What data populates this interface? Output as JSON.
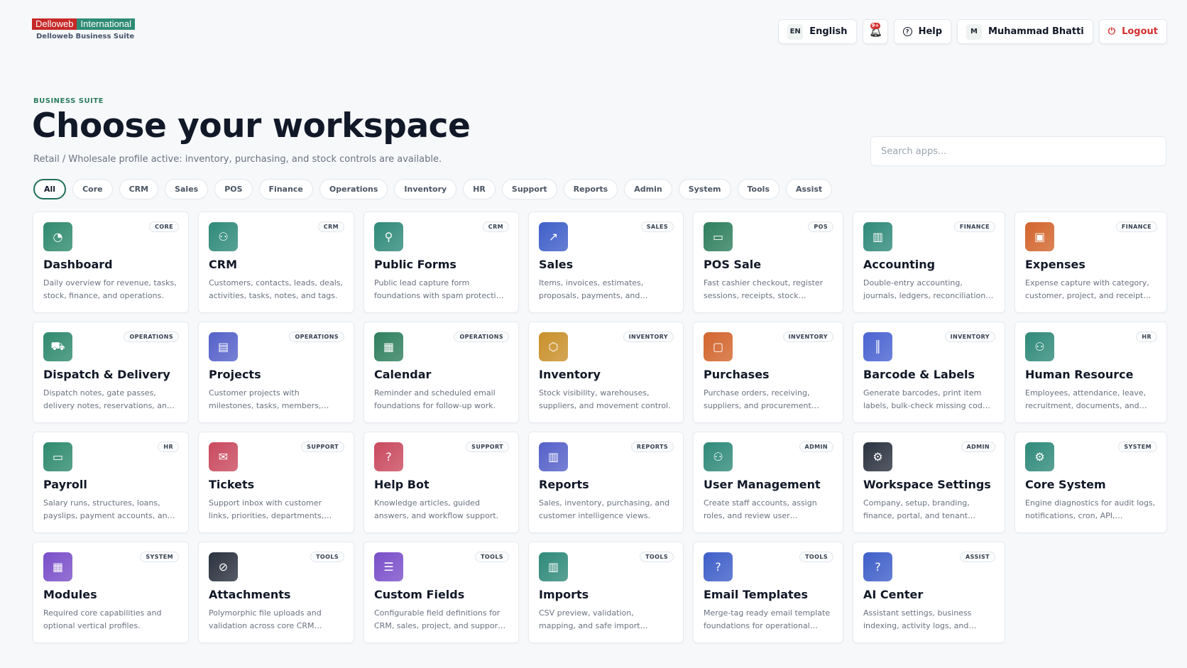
{
  "brand": {
    "logo_left": "Delloweb",
    "logo_right": "International",
    "subtitle": "Delloweb Business Suite"
  },
  "topbar": {
    "language_code": "EN",
    "language_label": "English",
    "notification_count": "9+",
    "help_label": "Help",
    "user_initial": "M",
    "user_name": "Muhammad Bhatti",
    "logout_label": "Logout"
  },
  "hero": {
    "eyebrow": "BUSINESS SUITE",
    "title": "Choose your workspace",
    "subtitle": "Retail / Wholesale profile active: inventory, purchasing, and stock controls are available."
  },
  "search": {
    "placeholder": "Search apps..."
  },
  "filters": [
    "All",
    "Core",
    "CRM",
    "Sales",
    "POS",
    "Finance",
    "Operations",
    "Inventory",
    "HR",
    "Support",
    "Reports",
    "Admin",
    "System",
    "Tools",
    "Assist"
  ],
  "active_filter": "All",
  "apps": [
    {
      "name": "Dashboard",
      "tag": "CORE",
      "desc": "Daily overview for revenue, tasks, stock, finance, and operations.",
      "icon": "gauge-icon",
      "glyph": "◔",
      "color": "#2f8a6e"
    },
    {
      "name": "CRM",
      "tag": "CRM",
      "desc": "Customers, contacts, leads, deals, activities, tasks, notes, and tags.",
      "icon": "users-icon",
      "glyph": "⚇",
      "color": "#2f8a7a"
    },
    {
      "name": "Public Forms",
      "tag": "CRM",
      "desc": "Public lead capture form foundations with spam protection and routing.",
      "icon": "form-icon",
      "glyph": "⚲",
      "color": "#2f8a7a"
    },
    {
      "name": "Sales",
      "tag": "SALES",
      "desc": "Items, invoices, estimates, proposals, payments, and revenue tracking.",
      "icon": "trend-icon",
      "glyph": "↗",
      "color": "#3f5fc9"
    },
    {
      "name": "POS Sale",
      "tag": "POS",
      "desc": "Fast cashier checkout, register sessions, receipts, stock deduction and more.",
      "icon": "card-icon",
      "glyph": "▭",
      "color": "#2f7f5e"
    },
    {
      "name": "Accounting",
      "tag": "FINANCE",
      "desc": "Double-entry accounting, journals, ledgers, reconciliation, period closing.",
      "icon": "bar-chart-icon",
      "glyph": "▥",
      "color": "#2f8a7a"
    },
    {
      "name": "Expenses",
      "tag": "FINANCE",
      "desc": "Expense capture with category, customer, project, and receipt tracking.",
      "icon": "wallet-icon",
      "glyph": "▣",
      "color": "#d2652d"
    },
    {
      "name": "Dispatch & Delivery",
      "tag": "OPERATIONS",
      "desc": "Dispatch notes, gate passes, delivery notes, reservations, and tracking.",
      "icon": "truck-icon",
      "glyph": "⛟",
      "color": "#2f8a6e"
    },
    {
      "name": "Projects",
      "tag": "OPERATIONS",
      "desc": "Customer projects with milestones, tasks, members, deadlines, and budgets.",
      "icon": "folder-icon",
      "glyph": "▤",
      "color": "#5561c9"
    },
    {
      "name": "Calendar",
      "tag": "OPERATIONS",
      "desc": "Reminder and scheduled email foundations for follow-up work.",
      "icon": "clipboard-icon",
      "glyph": "▦",
      "color": "#2f7f5e"
    },
    {
      "name": "Inventory",
      "tag": "INVENTORY",
      "desc": "Stock visibility, warehouses, suppliers, and movement control.",
      "icon": "box-icon",
      "glyph": "⬡",
      "color": "#c9902b"
    },
    {
      "name": "Purchases",
      "tag": "INVENTORY",
      "desc": "Purchase orders, receiving, suppliers, and procurement follow-up.",
      "icon": "bag-icon",
      "glyph": "▢",
      "color": "#d2652d"
    },
    {
      "name": "Barcode & Labels",
      "tag": "INVENTORY",
      "desc": "Generate barcodes, print item labels, bulk-check missing codes, and more.",
      "icon": "barcode-icon",
      "glyph": "║",
      "color": "#4a63d1"
    },
    {
      "name": "Human Resource",
      "tag": "HR",
      "desc": "Employees, attendance, leave, recruitment, documents, and payroll links.",
      "icon": "people-icon",
      "glyph": "⚇",
      "color": "#2f8a7a"
    },
    {
      "name": "Payroll",
      "tag": "HR",
      "desc": "Salary runs, structures, loans, payslips, payment accounts, and reports.",
      "icon": "money-icon",
      "glyph": "▭",
      "color": "#2f8a6e"
    },
    {
      "name": "Tickets",
      "tag": "SUPPORT",
      "desc": "Support inbox with customer links, priorities, departments, replies, and SLAs.",
      "icon": "ticket-icon",
      "glyph": "✉",
      "color": "#c94a5f"
    },
    {
      "name": "Help Bot",
      "tag": "SUPPORT",
      "desc": "Knowledge articles, guided answers, and workflow support.",
      "icon": "help-circle-icon",
      "glyph": "?",
      "color": "#c94a5f"
    },
    {
      "name": "Reports",
      "tag": "REPORTS",
      "desc": "Sales, inventory, purchasing, and customer intelligence views.",
      "icon": "bar-chart-icon",
      "glyph": "▥",
      "color": "#5561c9"
    },
    {
      "name": "User Management",
      "tag": "ADMIN",
      "desc": "Create staff accounts, assign roles, and review user permissions.",
      "icon": "user-group-icon",
      "glyph": "⚇",
      "color": "#2f8a7a"
    },
    {
      "name": "Workspace Settings",
      "tag": "ADMIN",
      "desc": "Company, setup, branding, finance, portal, and tenant configuration.",
      "icon": "gear-icon",
      "glyph": "⚙",
      "color": "#2b3340"
    },
    {
      "name": "Core System",
      "tag": "SYSTEM",
      "desc": "Engine diagnostics for audit logs, notifications, cron, API, webhooks.",
      "icon": "gear-icon",
      "glyph": "⚙",
      "color": "#2f8a7a"
    },
    {
      "name": "Modules",
      "tag": "SYSTEM",
      "desc": "Required core capabilities and optional vertical profiles.",
      "icon": "modules-icon",
      "glyph": "▦",
      "color": "#7a4fc9"
    },
    {
      "name": "Attachments",
      "tag": "TOOLS",
      "desc": "Polymorphic file uploads and validation across core CRM modules.",
      "icon": "paperclip-icon",
      "glyph": "⊘",
      "color": "#2b3340"
    },
    {
      "name": "Custom Fields",
      "tag": "TOOLS",
      "desc": "Configurable field definitions for CRM, sales, project, and support records.",
      "icon": "sliders-icon",
      "glyph": "☰",
      "color": "#7a4fc9"
    },
    {
      "name": "Imports",
      "tag": "TOOLS",
      "desc": "CSV preview, validation, mapping, and safe import workflow.",
      "icon": "bar-chart-icon",
      "glyph": "▥",
      "color": "#2f8a7a"
    },
    {
      "name": "Email Templates",
      "tag": "TOOLS",
      "desc": "Merge-tag ready email template foundations for operational messages.",
      "icon": "help-circle-icon",
      "glyph": "?",
      "color": "#3f5fc9"
    },
    {
      "name": "AI Center",
      "tag": "ASSIST",
      "desc": "Assistant settings, business indexing, activity logs, and usage controls.",
      "icon": "help-circle-icon",
      "glyph": "?",
      "color": "#3f5fc9"
    }
  ]
}
